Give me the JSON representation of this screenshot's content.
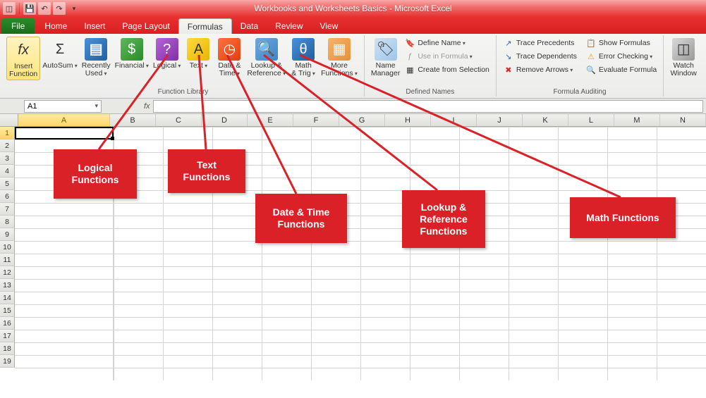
{
  "title": "Workbooks and Worksheets Basics - Microsoft Excel",
  "tabs": {
    "file": "File",
    "home": "Home",
    "insert": "Insert",
    "pagelayout": "Page Layout",
    "formulas": "Formulas",
    "data": "Data",
    "review": "Review",
    "view": "View"
  },
  "ribbon": {
    "insert_function": "Insert\nFunction",
    "autosum": "AutoSum",
    "recently": "Recently\nUsed",
    "financial": "Financial",
    "logical": "Logical",
    "text": "Text",
    "datetime": "Date &\nTime",
    "lookup": "Lookup &\nReference",
    "math": "Math\n& Trig",
    "more": "More\nFunctions",
    "group_funclib": "Function Library",
    "name_mgr": "Name\nManager",
    "define_name": "Define Name",
    "use_in_formula": "Use in Formula",
    "create_sel": "Create from Selection",
    "group_defnames": "Defined Names",
    "trace_prec": "Trace Precedents",
    "trace_dep": "Trace Dependents",
    "remove_arr": "Remove Arrows",
    "show_form": "Show Formulas",
    "err_check": "Error Checking",
    "eval_form": "Evaluate Formula",
    "group_audit": "Formula Auditing",
    "watch": "Watch\nWindow"
  },
  "namebox": "A1",
  "fx": "fx",
  "columns": [
    "A",
    "B",
    "C",
    "D",
    "E",
    "F",
    "G",
    "H",
    "I",
    "J",
    "K",
    "L",
    "M",
    "N"
  ],
  "rows": [
    "1",
    "2",
    "3",
    "4",
    "5",
    "6",
    "7",
    "8",
    "9",
    "10",
    "11",
    "12",
    "13",
    "14",
    "15",
    "16",
    "17",
    "18",
    "19"
  ],
  "callouts": {
    "logical": "Logical Functions",
    "text": "Text Functions",
    "datetime": "Date & Time Functions",
    "lookup": "Lookup & Reference Functions",
    "math": "Math Functions"
  }
}
